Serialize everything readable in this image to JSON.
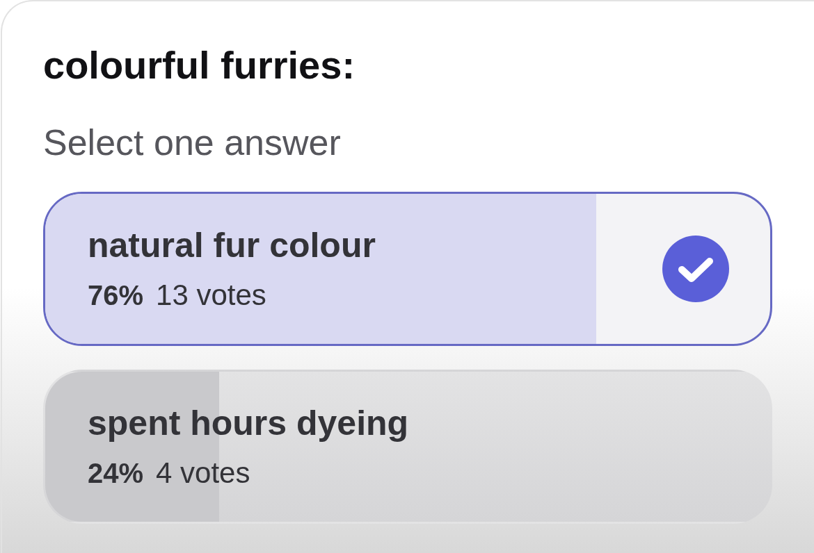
{
  "poll": {
    "question": "colourful furries:",
    "instruction": "Select one answer",
    "options": [
      {
        "label": "natural fur colour",
        "percent": "76%",
        "votes": "13 votes",
        "level": 0.76,
        "selected": true
      },
      {
        "label": "spent hours dyeing",
        "percent": "24%",
        "votes": "4 votes",
        "level": 0.24,
        "selected": false
      }
    ]
  }
}
